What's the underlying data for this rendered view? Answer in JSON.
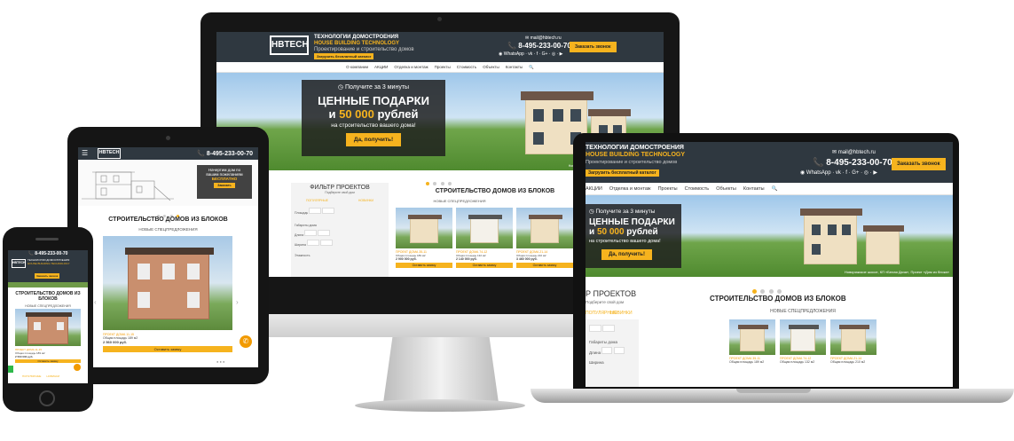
{
  "site": {
    "logo_text": "HBTECH",
    "logo_sub": "СТРОИТЕЛЬНАЯ КОМПАНИЯ",
    "tagline_line1": "ТЕХНОЛОГИИ ДОМОСТРОЕНИЯ",
    "tagline_line2": "HOUSE BUILDING TECHNOLOGY",
    "tagline_line3": "Проектирование и строительство домов",
    "download_button": "Загрузить бесплатный каталог",
    "email": "mail@hbtech.ru",
    "phone": "8-495-233-00-70",
    "whatsapp": "WhatsApp",
    "callback_button": "Заказать звонок",
    "nav": [
      "О компании",
      "АКЦИИ",
      "Отделка и монтаж",
      "Проекты",
      "Стоимость",
      "Объекты",
      "Контакты"
    ],
    "hero": {
      "line1": "Получите за 3 минуты",
      "line2": "ЦЕННЫЕ ПОДАРКИ",
      "line3_prefix": "и ",
      "line3_highlight": "50 000",
      "line3_suffix": " рублей",
      "line4": "на строительство вашего дома!",
      "button": "Да, получить!",
      "caption": "Новорижское шоссе, КП «Белая Дача», Проект «Дом из блока»"
    },
    "filter": {
      "title": "ФИЛЬТР ПРОЕКТОВ",
      "subtitle": "Подберите свой дом",
      "tab_popular": "ПОПУЛЯРНЫЕ",
      "tab_new": "НОВИНКИ",
      "area_label": "Площадь",
      "dims_label": "Габариты дома",
      "length_label": "Длина",
      "width_label": "Ширина",
      "floors_label": "Этажность",
      "from_label": "от",
      "to_label": "до"
    },
    "section_title": "СТРОИТЕЛЬСТВО ДОМОВ ИЗ БЛОКОВ",
    "section_title_phone_1": "СТРОИТЕЛЬСТВО ДОМОВ ИЗ",
    "section_title_phone_2": "БЛОКОВ",
    "section_title_laptop": "СТРОИТЕЛЬСТВО ДОМОВ ИЗ БЛОКОВ",
    "subtitle": "НОВЫЕ СПЕЦПРЕДЛОЖЕНИЯ",
    "filter_title_laptop": "Р ПРОЕКТОВ",
    "filter_sub_laptop": "Подберите свой дом",
    "cards": [
      {
        "title": "ПРОЕКТ ДОМА 35-11",
        "area": "Общая площадь 189 м2",
        "price": "2 900 000 руб."
      },
      {
        "title": "ПРОЕКТ ДОМА 74-12",
        "area": "Общая площадь 132 м2",
        "price": "2 140 000 руб."
      },
      {
        "title": "ПРОЕКТ ДОМА 21-14",
        "area": "Общая площадь 210 м2",
        "price": "3 460 000 руб."
      }
    ],
    "order_button": "Оставить заявку",
    "tablet_promo_line1": "Начертим дом по",
    "tablet_promo_line2": "вашим пожеланиям",
    "tablet_promo_highlight": "БЕСПЛАТНО",
    "tablet_promo_button": "Заказать",
    "phone_card_title": "ПРОЕКТ ДОМА 11-15",
    "phone_card_area": "Общая площадь 189 м2",
    "phone_card_price": "2 560 000 руб.",
    "phone_tabs": [
      "ПОПУЛЯРНЫЕ",
      "НОВИНКИ"
    ]
  },
  "colors": {
    "accent": "#f6b31e",
    "header": "#2f3840",
    "text": "#222222"
  }
}
